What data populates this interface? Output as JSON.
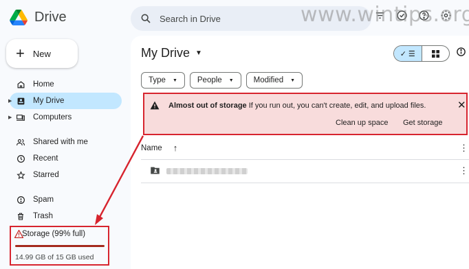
{
  "app": {
    "name": "Drive"
  },
  "watermark": "www.wintips.org",
  "new_button": {
    "label": "New"
  },
  "sidebar": {
    "items": [
      {
        "label": "Home",
        "icon": "home-icon"
      },
      {
        "label": "My Drive",
        "icon": "my-drive-icon",
        "active": true
      },
      {
        "label": "Computers",
        "icon": "computer-icon"
      },
      {
        "label": "Shared with me",
        "icon": "people-icon"
      },
      {
        "label": "Recent",
        "icon": "clock-icon"
      },
      {
        "label": "Starred",
        "icon": "star-icon"
      },
      {
        "label": "Spam",
        "icon": "spam-icon"
      },
      {
        "label": "Trash",
        "icon": "trash-icon"
      }
    ],
    "storage": {
      "label": "Storage (99% full)",
      "used_text": "14.99 GB of 15 GB used",
      "fraction_used": 0.99
    }
  },
  "search": {
    "placeholder": "Search in Drive"
  },
  "main": {
    "title": "My Drive",
    "filters": [
      "Type",
      "People",
      "Modified"
    ],
    "alert": {
      "title": "Almost out of storage",
      "message": "If you run out, you can't create, edit, and upload files.",
      "actions": [
        "Clean up space",
        "Get storage"
      ]
    },
    "table": {
      "column_name": "Name"
    }
  },
  "colors": {
    "accent": "#c2e7ff",
    "alert_bg": "#f8dcdc",
    "highlight": "#d7242e"
  }
}
